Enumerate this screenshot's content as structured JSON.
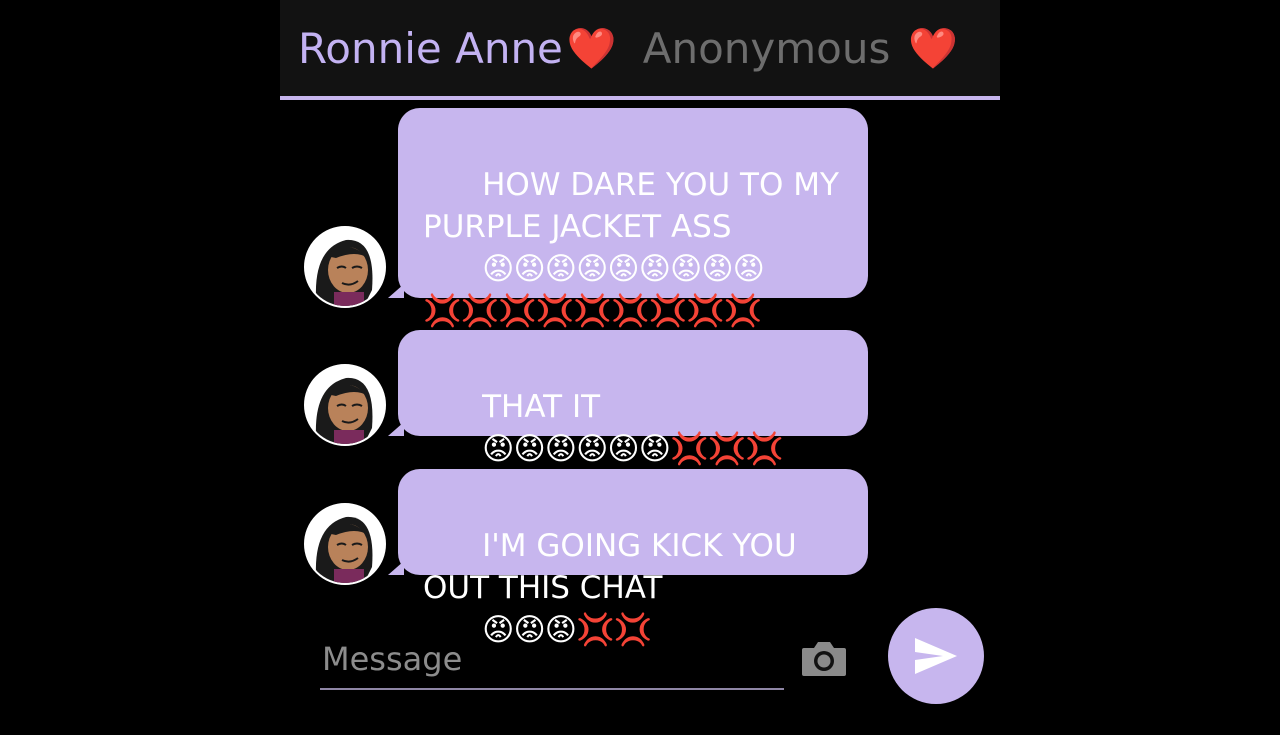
{
  "header": {
    "tab_active": "Ronnie Anne",
    "tab_active_emoji": "❤️",
    "tab_inactive": "Anonymous",
    "tab_inactive_emoji": "❤️"
  },
  "messages": [
    {
      "text": "HOW DARE YOU TO MY PURPLE JACKET ASS",
      "emojis": "😡😡😡😡😡😡😡😡😡💢💢💢💢💢💢💢💢💢"
    },
    {
      "text": "THAT IT",
      "emojis": "😡😡😡😡😡😡💢💢💢"
    },
    {
      "text": "I'M GOING KICK YOU OUT THIS CHAT",
      "emojis": "😡😡😡💢💢"
    }
  ],
  "composer": {
    "placeholder": "Message"
  },
  "icons": {
    "camera": "camera-icon",
    "send": "send-icon"
  },
  "colors": {
    "accent": "#c7b6ee",
    "header_bg": "#121212",
    "inactive_tab": "#6d6d6d"
  }
}
